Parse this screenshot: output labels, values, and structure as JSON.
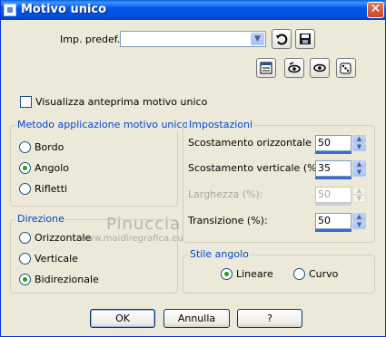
{
  "window": {
    "title": "Motivo unico",
    "close_glyph": "✕"
  },
  "preset": {
    "label": "Imp. predef.:",
    "value": ""
  },
  "preview_checkbox": {
    "label": "Visualizza anteprima motivo unico",
    "checked": false
  },
  "method_group": {
    "title": "Metodo applicazione motivo unico",
    "options": [
      {
        "label": "Bordo",
        "selected": false
      },
      {
        "label": "Angolo",
        "selected": true
      },
      {
        "label": "Rifletti",
        "selected": false
      }
    ]
  },
  "direction_group": {
    "title": "Direzione",
    "options": [
      {
        "label": "Orizzontale",
        "selected": false
      },
      {
        "label": "Verticale",
        "selected": false
      },
      {
        "label": "Bidirezionale",
        "selected": true
      }
    ]
  },
  "settings_group": {
    "title": "Impostazioni",
    "fields": [
      {
        "label": "Scostamento orizzontale (%):",
        "value": "50",
        "enabled": true
      },
      {
        "label": "Scostamento verticale (%):",
        "value": "35",
        "enabled": true
      },
      {
        "label": "Larghezza (%):",
        "value": "50",
        "enabled": false
      },
      {
        "label": "Transizione (%):",
        "value": "50",
        "enabled": true
      }
    ]
  },
  "corner_style_group": {
    "title": "Stile angolo",
    "options": [
      {
        "label": "Lineare",
        "selected": true
      },
      {
        "label": "Curvo",
        "selected": false
      }
    ]
  },
  "buttons": {
    "ok": "OK",
    "cancel": "Annulla",
    "help": "?"
  },
  "watermark": {
    "line1": "Pinuccia",
    "line2": "www.maidiregrafica.eu"
  },
  "colors": {
    "titlebar": "#0058ee",
    "group_title": "#0046d5",
    "dialog_bg": "#ece9d8"
  }
}
